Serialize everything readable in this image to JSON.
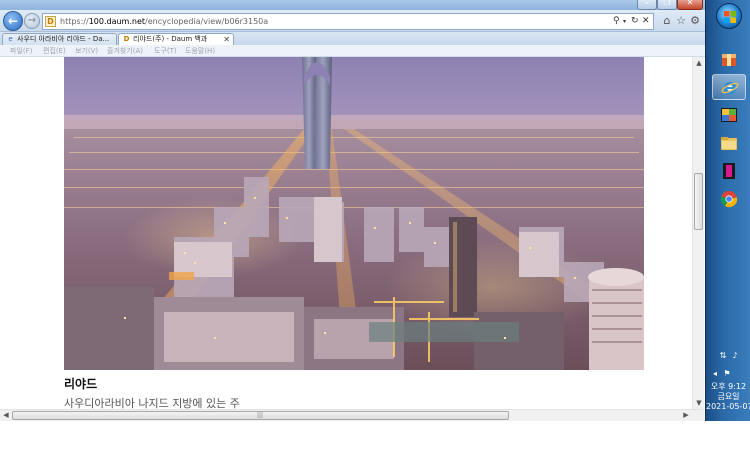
{
  "browser": {
    "address": {
      "scheme": "https://",
      "host": "100.daum.net",
      "path": "/encyclopedia/view/b06r3150a"
    },
    "tabs": [
      {
        "label": "사우디 아라비아 리야드 - Da...",
        "active": false
      },
      {
        "label": "리야드(주) - Daum 백과",
        "active": true
      }
    ],
    "menu": [
      "파일(F)",
      "편집(E)",
      "보기(V)",
      "즐겨찾기(A)",
      "도구(T)",
      "도움말(H)"
    ]
  },
  "article": {
    "title": "리야드",
    "description": "사우디아라비아 나지드 지방에 있는 주"
  },
  "taskbar": {
    "clock": {
      "time": "오후 9:12",
      "weekday": "금요일",
      "date": "2021-05-07"
    }
  },
  "colors": {
    "taskbar": "#2a6aa8",
    "sky_top": "#8f83b4",
    "sky_bottom": "#d6b7c9",
    "city_light": "#ffcf7a"
  }
}
